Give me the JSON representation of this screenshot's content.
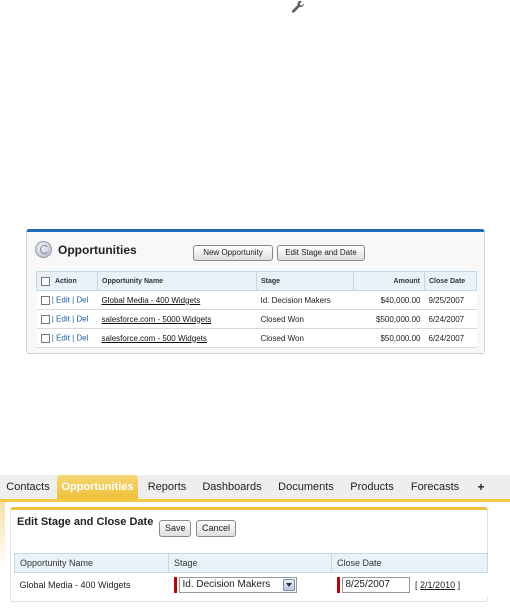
{
  "related_list": {
    "title": "Opportunities",
    "buttons": {
      "new": "New Opportunity",
      "edit_stage": "Edit Stage and Date"
    },
    "columns": [
      "Action",
      "Opportunity Name",
      "Stage",
      "Amount",
      "Close Date"
    ],
    "action_links": {
      "edit": "Edit",
      "del": "Del",
      "sep": "|"
    },
    "rows": [
      {
        "name": "Global Media - 400 Widgets",
        "stage": "Id. Decision Makers",
        "amount": "$40,000.00",
        "close_date": "9/25/2007"
      },
      {
        "name": "salesforce.com - 5000 Widgets",
        "stage": "Closed Won",
        "amount": "$500,000.00",
        "close_date": "6/24/2007"
      },
      {
        "name": "salesforce.com - 500 Widgets",
        "stage": "Closed Won",
        "amount": "$50,000.00",
        "close_date": "6/24/2007"
      }
    ]
  },
  "tabs": [
    "Contacts",
    "Opportunities",
    "Reports",
    "Dashboards",
    "Documents",
    "Products",
    "Forecasts",
    "+"
  ],
  "active_tab": "Opportunities",
  "mass_edit": {
    "title": "Edit Stage and Close Date",
    "save_label": "Save",
    "cancel_label": "Cancel",
    "columns": [
      "Opportunity Name",
      "Stage",
      "Close Date"
    ],
    "row": {
      "name": "Global Media - 400 Widgets",
      "stage": "Id. Decision Makers",
      "close_date": "8/25/2007",
      "today_link": "2/1/2010",
      "bracket_open": "[",
      "bracket_close": "]"
    }
  },
  "colors": {
    "accent_blue": "#1d6cb5",
    "tab_gold": "#efbf38",
    "link_blue": "#1d5fa6",
    "required_red": "#c00000"
  },
  "icons": [
    "wrench-icon",
    "opportunities-icon",
    "dropdown-arrow-icon"
  ]
}
